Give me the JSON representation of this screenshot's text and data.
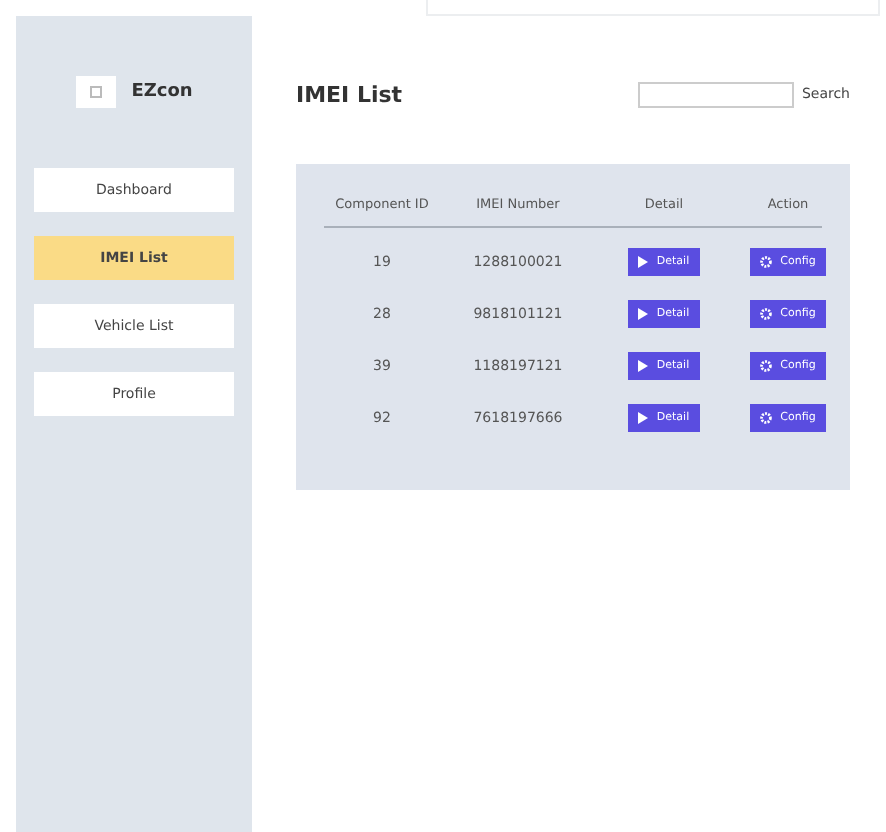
{
  "sidebar": {
    "logo": {
      "text": "EZcon"
    },
    "items": [
      {
        "label": "Dashboard",
        "selected": false
      },
      {
        "label": "IMEI List",
        "selected": true
      },
      {
        "label": "Vehicle List",
        "selected": false
      },
      {
        "label": "Profile",
        "selected": false
      }
    ]
  },
  "header": {
    "title": "IMEI List",
    "search": {
      "button": "Search"
    }
  },
  "table": {
    "columns": [
      "Component ID",
      "IMEI Number",
      "Detail",
      "Action"
    ],
    "rows": [
      {
        "component_id": "19",
        "imei": "1288100021",
        "detail": "Detail",
        "action": "Config"
      },
      {
        "component_id": "28",
        "imei": "9818101121",
        "detail": "Detail",
        "action": "Config"
      },
      {
        "component_id": "39",
        "imei": "1188197121",
        "detail": "Detail",
        "action": "Config"
      },
      {
        "component_id": "92",
        "imei": "7618197666",
        "detail": "Detail",
        "action": "Config"
      }
    ]
  }
}
